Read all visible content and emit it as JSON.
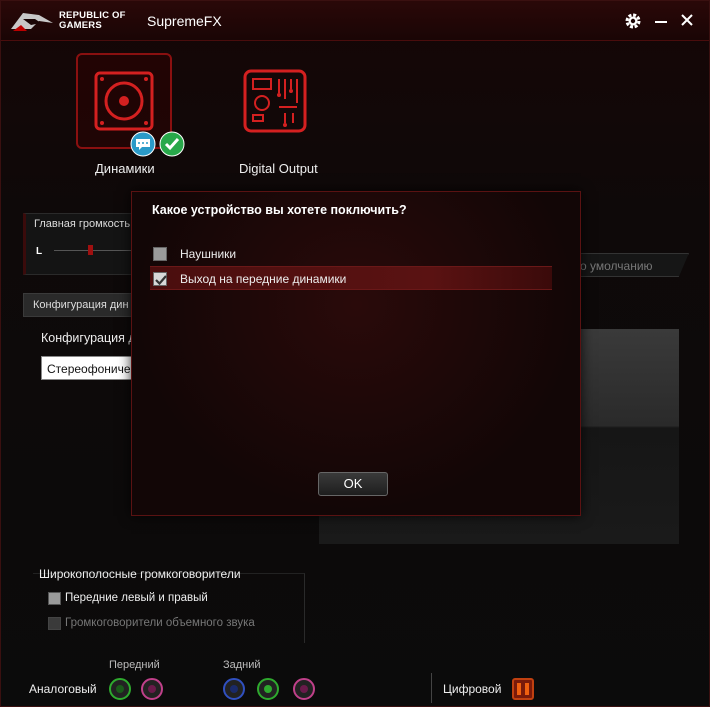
{
  "window": {
    "brand_line1": "REPUBLIC OF",
    "brand_line2": "GAMERS",
    "title": "SupremeFX"
  },
  "devices": [
    {
      "label": "Динамики",
      "icon": "speaker-icon",
      "selected": true
    },
    {
      "label": "Digital Output",
      "icon": "circuit-board-icon",
      "selected": false
    }
  ],
  "volume": {
    "title": "Главная громкость",
    "channel": "L"
  },
  "default_button": "о умолчанию",
  "config": {
    "tab": "Конфигурация дин",
    "label": "Конфигурация д",
    "select_value": "Стереофоничес"
  },
  "dialog": {
    "title": "Какое устройство вы хотете поключить?",
    "options": [
      {
        "label": "Наушники",
        "checked": false
      },
      {
        "label": "Выход на передние динамики",
        "checked": true
      }
    ],
    "ok": "OK"
  },
  "wideband": {
    "title": "Широкополосные громкоговорители",
    "options": [
      {
        "label": "Передние левый и правый",
        "enabled": true
      },
      {
        "label": "Громкоговорители объемного звука",
        "enabled": false
      }
    ]
  },
  "jacks": {
    "front": "Передний",
    "rear": "Задний",
    "analog": "Аналоговый",
    "digital": "Цифровой"
  },
  "colors": {
    "accent": "#c01818",
    "jack_green": "#2eaa2e",
    "jack_pink": "#c0408a",
    "jack_blue": "#3050c0"
  }
}
